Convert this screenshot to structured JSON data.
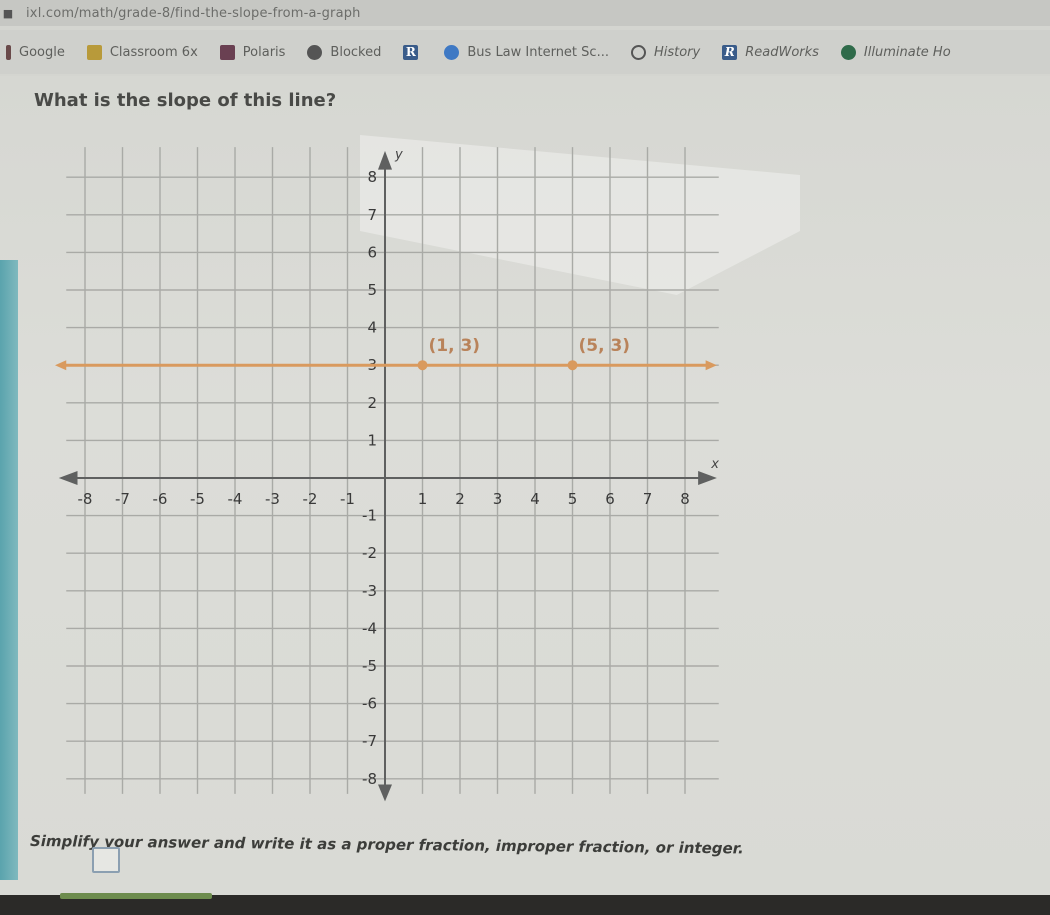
{
  "browser": {
    "url": "ixl.com/math/grade-8/find-the-slope-from-a-graph",
    "bookmarks": [
      {
        "label": "Google",
        "icon": "bookmark-bar-icon"
      },
      {
        "label": "Classroom 6x",
        "icon": "classroom-icon"
      },
      {
        "label": "Polaris",
        "icon": "polaris-icon"
      },
      {
        "label": "Blocked",
        "icon": "globe-icon"
      },
      {
        "label": "",
        "icon": "r-icon"
      },
      {
        "label": "Bus Law Internet Sc...",
        "icon": "compass-icon"
      },
      {
        "label": "History",
        "icon": "clock-icon"
      },
      {
        "label": "ReadWorks",
        "icon": "readworks-r-icon"
      },
      {
        "label": "Illuminate Ho",
        "icon": "illuminate-dot-icon"
      }
    ]
  },
  "question": {
    "prompt": "What is the slope of this line?",
    "instruction": "Simplify your answer and write it as a proper fraction, improper fraction, or integer.",
    "answer_value": ""
  },
  "chart_data": {
    "type": "line",
    "title": "",
    "xlabel": "x",
    "ylabel": "y",
    "xlim": [
      -8,
      8
    ],
    "ylim": [
      -8,
      8
    ],
    "grid": true,
    "x_ticks": [
      "-8",
      "-7",
      "-6",
      "-5",
      "-4",
      "-3",
      "-2",
      "-1",
      "1",
      "2",
      "3",
      "4",
      "5",
      "6",
      "7",
      "8"
    ],
    "y_ticks": [
      "8",
      "7",
      "6",
      "5",
      "4",
      "3",
      "2",
      "1",
      "-1",
      "-2",
      "-3",
      "-4",
      "-5",
      "-6",
      "-7",
      "-8"
    ],
    "series": [
      {
        "name": "line",
        "color": "#d99a5e",
        "equation": "y = 3",
        "points": [
          [
            1,
            3
          ],
          [
            5,
            3
          ]
        ]
      }
    ],
    "annotations": [
      {
        "text": "(1, 3)",
        "x": 1,
        "y": 3
      },
      {
        "text": "(5, 3)",
        "x": 5,
        "y": 3
      }
    ]
  },
  "colors": {
    "line": "#d99a5e",
    "axis": "#5f6060",
    "grid": "#a9aaa6"
  }
}
